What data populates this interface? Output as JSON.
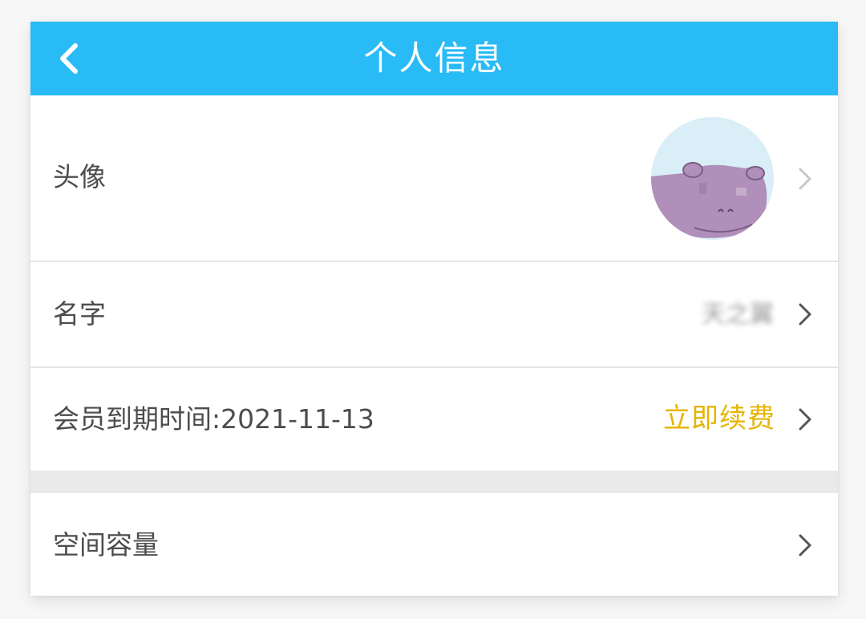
{
  "header": {
    "title": "个人信息",
    "back_icon": "chevron-left-icon",
    "background_color": "#29bbf5"
  },
  "rows": {
    "avatar": {
      "label": "头像",
      "icon": "chevron-right-icon"
    },
    "name": {
      "label": "名字",
      "value": "天之翼",
      "icon": "chevron-right-icon"
    },
    "membership": {
      "label": "会员到期时间:2021-11-13",
      "action_label": "立即续费",
      "action_color": "#e6b400",
      "icon": "chevron-right-icon"
    },
    "storage": {
      "label": "空间容量",
      "icon": "chevron-right-icon"
    }
  }
}
